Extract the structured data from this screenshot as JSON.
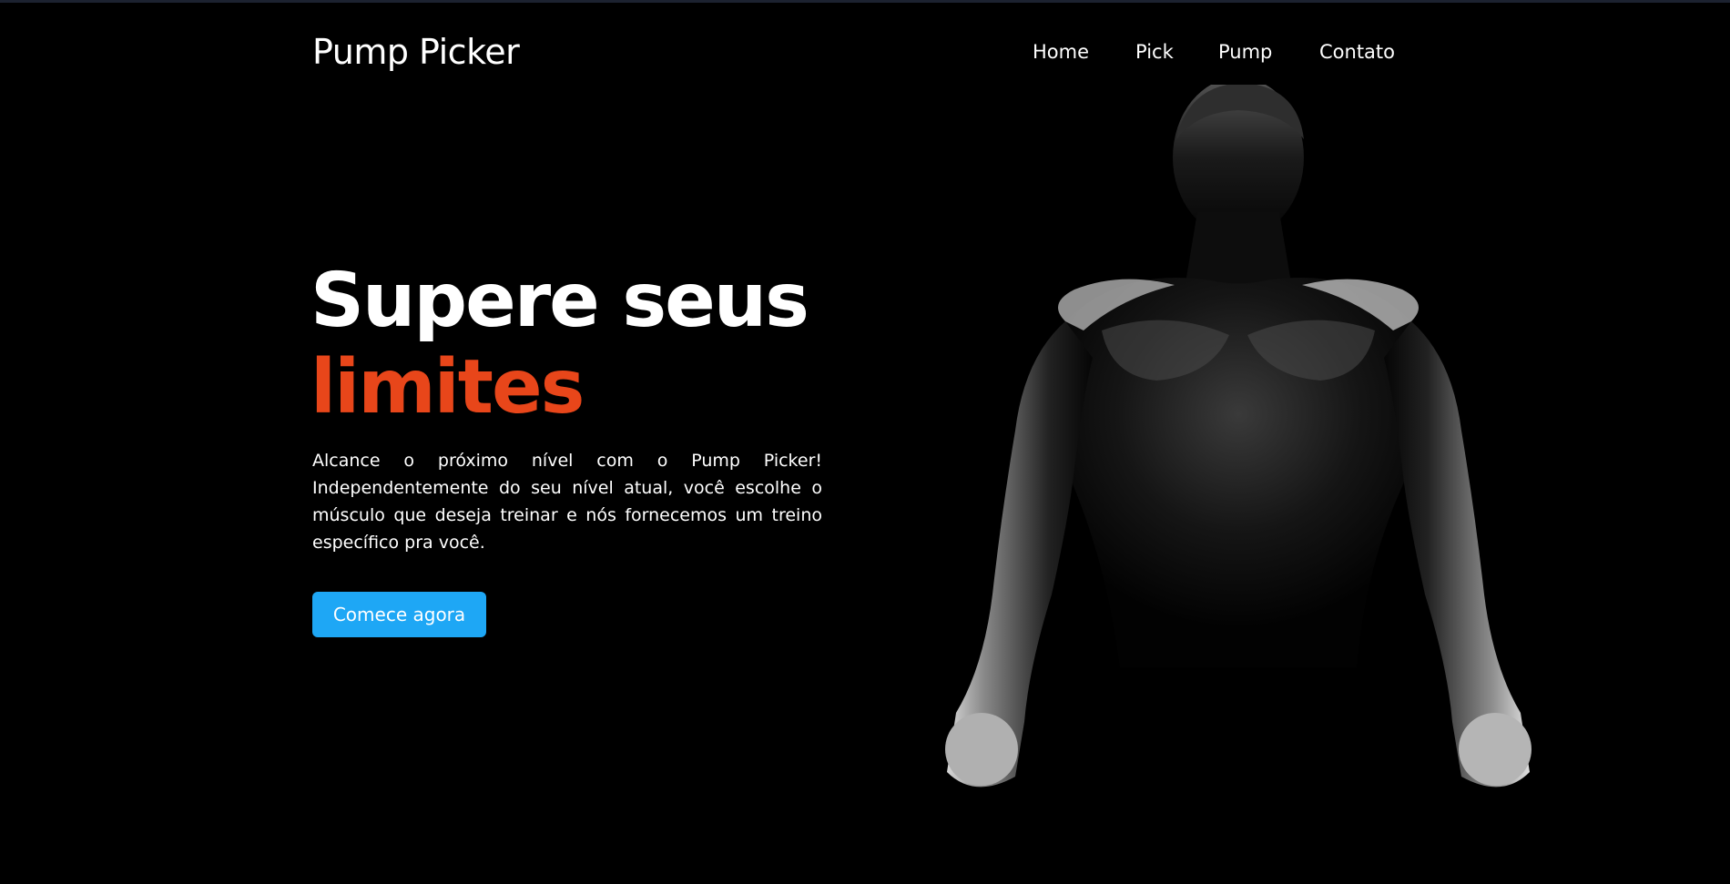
{
  "header": {
    "brand": "Pump Picker",
    "nav": [
      "Home",
      "Pick",
      "Pump",
      "Contato"
    ]
  },
  "hero": {
    "title_line1": "Supere seus",
    "title_line2": "limites",
    "text": "Alcance o próximo nível com o Pump Picker! Independentemente do seu nível atual, você escolhe o músculo que deseja treinar e nós fornecemos um treino específico pra você.",
    "cta_label": "Comece agora"
  },
  "colors": {
    "background": "#000000",
    "accent": "#e8461a",
    "button": "#1ea7f5",
    "text": "#ffffff"
  },
  "hero_image": {
    "description_icon": "muscular-man-silhouette"
  }
}
